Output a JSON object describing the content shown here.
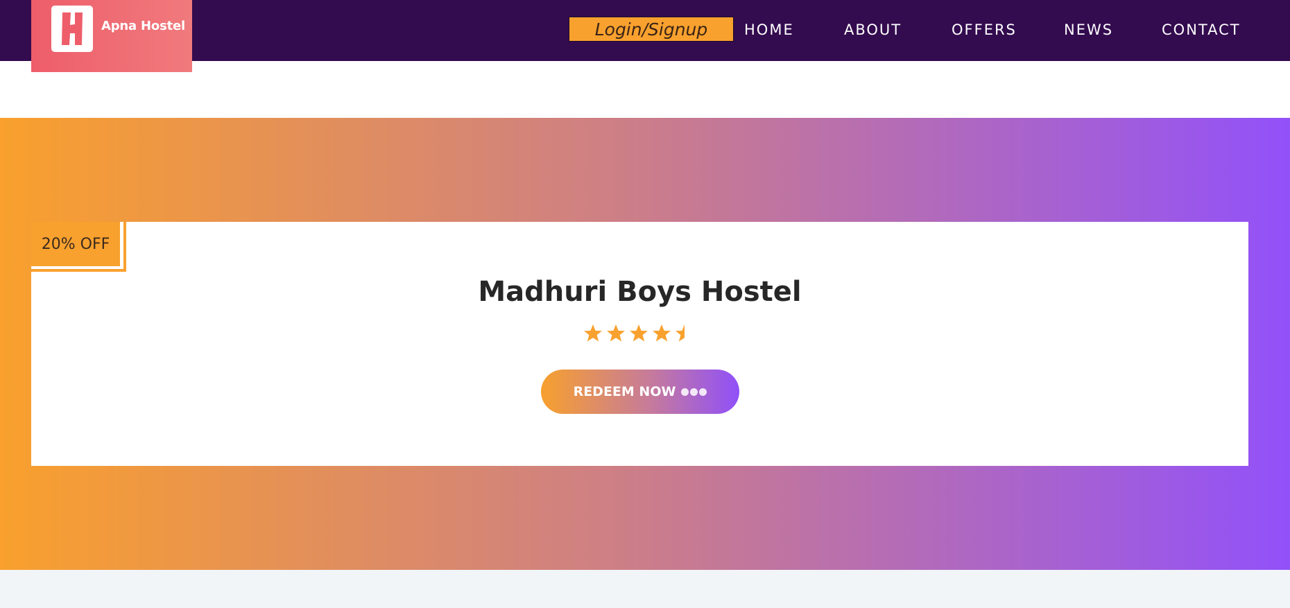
{
  "brand": {
    "name": "Apna Hostel",
    "icon": "hostel-h-logo-icon"
  },
  "nav": {
    "login_label": "Login/Signup",
    "links": [
      "HOME",
      "ABOUT",
      "OFFERS",
      "NEWS",
      "CONTACT"
    ]
  },
  "offer": {
    "discount": "20% OFF",
    "hostel_name": "Madhuri Boys Hostel",
    "rating": 4.5,
    "rating_max": 5,
    "star_icon": "star-icon",
    "button_label": "REDEEM NOW"
  },
  "colors": {
    "nav_bg": "#330b4f",
    "accent_orange": "#f9a12e",
    "accent_purple": "#9251f9",
    "logo_pink": "#ee5e6a"
  }
}
